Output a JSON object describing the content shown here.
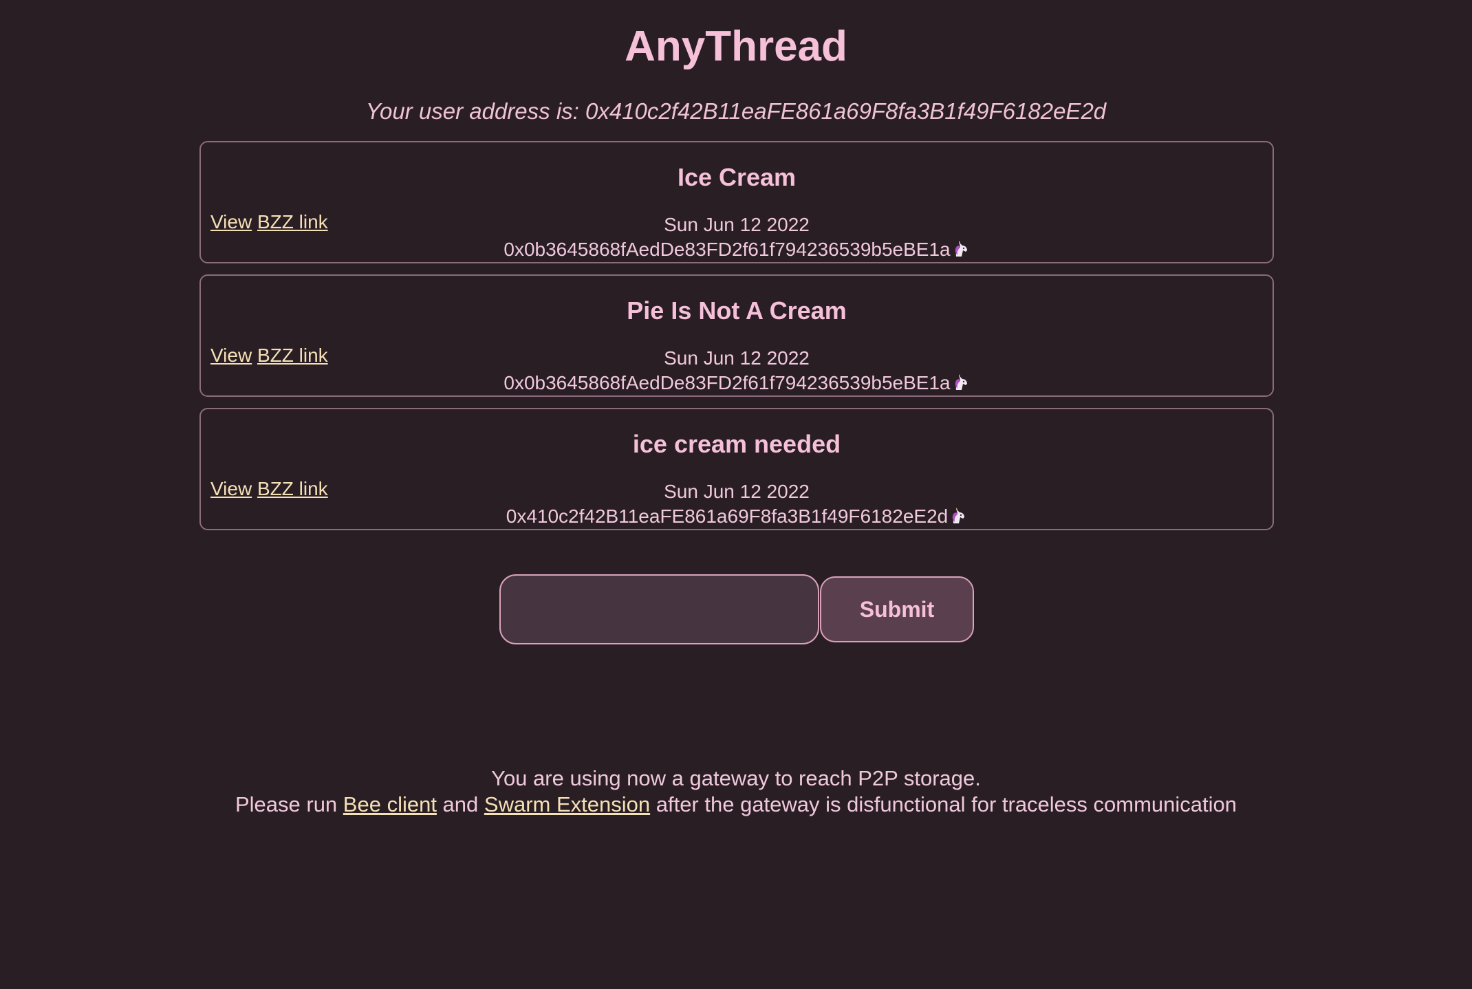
{
  "header": {
    "title": "AnyThread",
    "user_address_text": "Your user address is: 0x410c2f42B11eaFE861a69F8fa3B1f49F6182eE2d"
  },
  "threads": [
    {
      "title": "Ice Cream",
      "view_label": "View",
      "bzz_label": "BZZ link",
      "date": "Sun Jun 12 2022",
      "author": "0x0b3645868fAedDe83FD2f61f794236539b5eBE1a",
      "author_icon": "unicorn-icon"
    },
    {
      "title": "Pie Is Not A Cream",
      "view_label": "View",
      "bzz_label": "BZZ link",
      "date": "Sun Jun 12 2022",
      "author": "0x0b3645868fAedDe83FD2f61f794236539b5eBE1a",
      "author_icon": "unicorn-icon"
    },
    {
      "title": "ice cream needed",
      "view_label": "View",
      "bzz_label": "BZZ link",
      "date": "Sun Jun 12 2022",
      "author": "0x410c2f42B11eaFE861a69F8fa3B1f49F6182eE2d",
      "author_icon": "unicorn-icon"
    }
  ],
  "composer": {
    "input_value": "",
    "input_placeholder": "",
    "submit_label": "Submit"
  },
  "footer": {
    "line1": "You are using now a gateway to reach P2P storage.",
    "line2_prefix": "Please run ",
    "bee_link": "Bee client",
    "line2_and": " and ",
    "swarm_link": "Swarm Extension",
    "line2_suffix": " after the gateway is disfunctional for traceless communication"
  },
  "colors": {
    "background": "#291e24",
    "text_pink": "#f5c0d8",
    "link_cream": "#f5e1b6",
    "card_border": "#8c6b7c",
    "input_bg": "#463540",
    "button_bg": "#5a3f4e"
  }
}
